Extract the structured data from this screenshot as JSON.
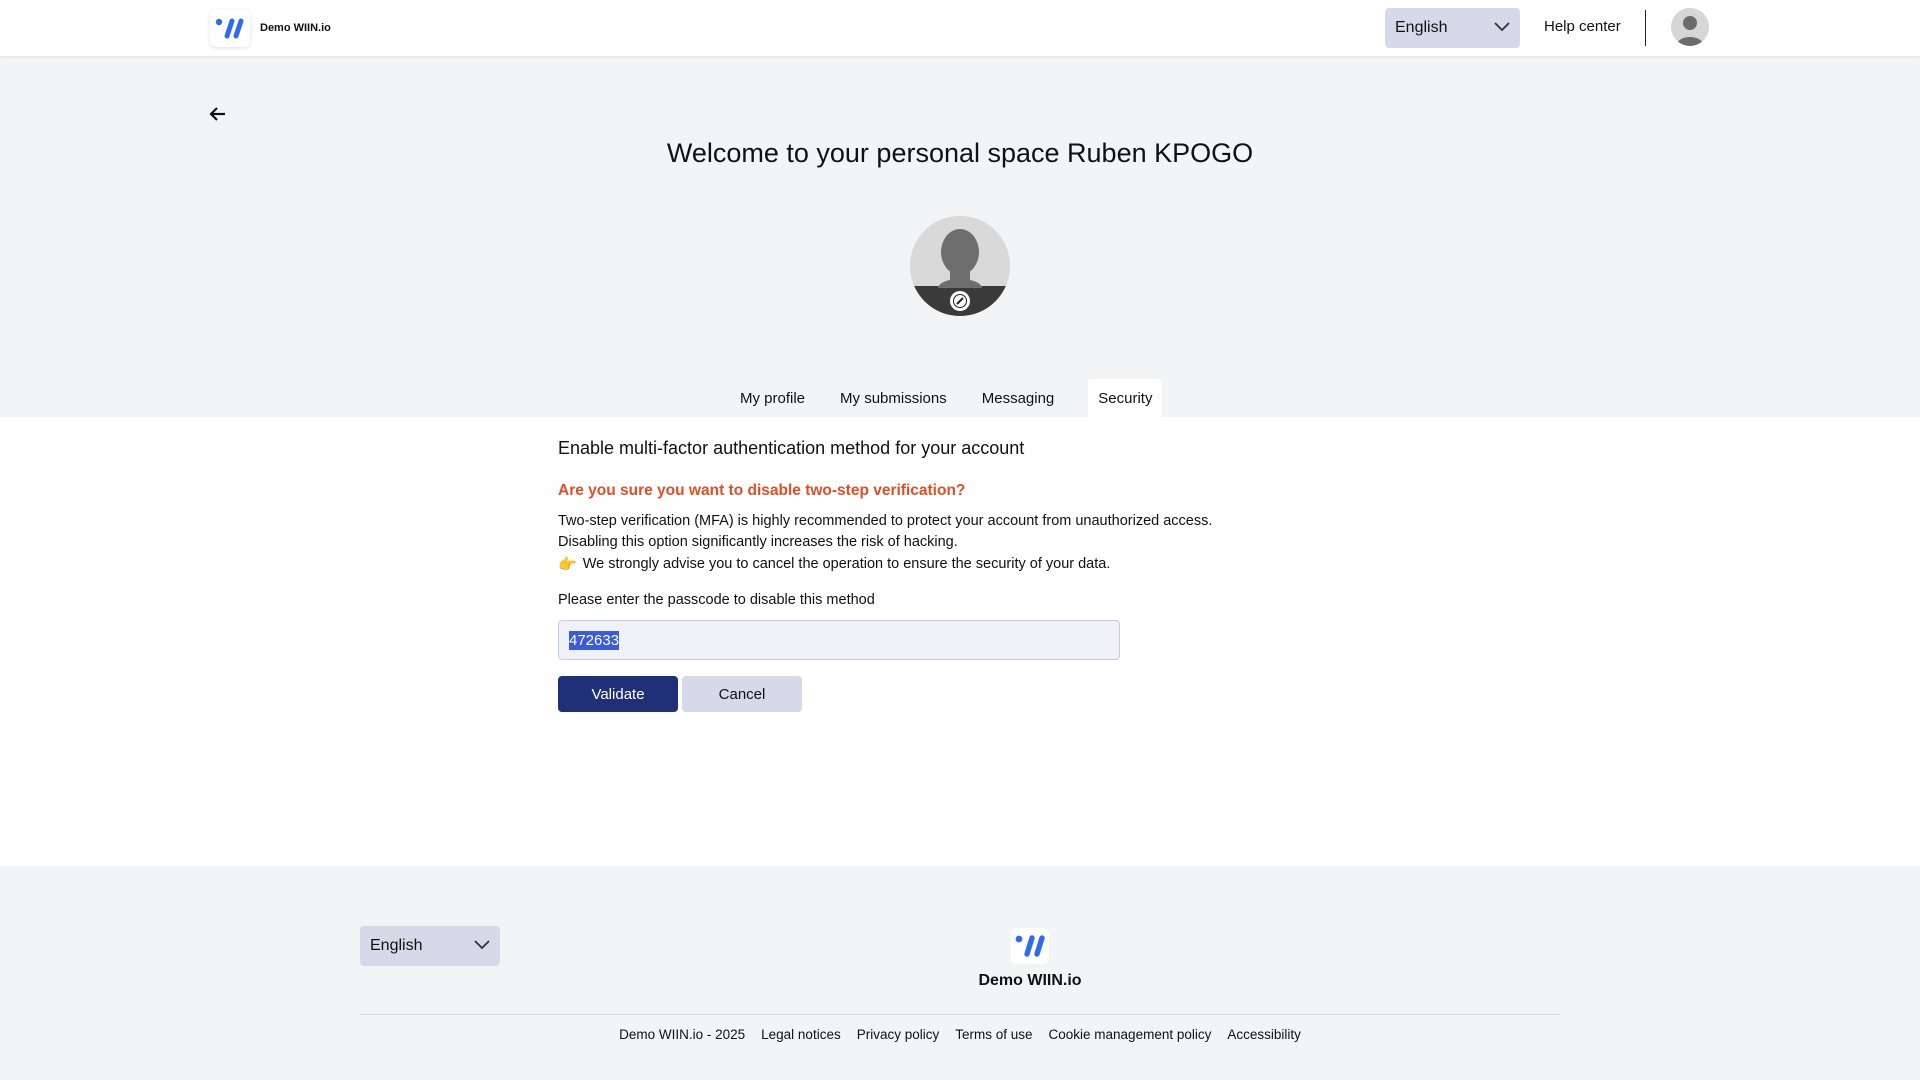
{
  "header": {
    "brand_name": "Demo WIIN.io",
    "language": "English",
    "help_center": "Help center"
  },
  "hero": {
    "welcome": "Welcome to your personal space Ruben KPOGO"
  },
  "tabs": [
    {
      "label": "My profile"
    },
    {
      "label": "My submissions"
    },
    {
      "label": "Messaging"
    },
    {
      "label": "Security",
      "active": true
    }
  ],
  "security": {
    "section_title": "Enable multi-factor authentication method for your account",
    "warning_title": "Are you sure you want to disable two-step verification?",
    "desc_line1": "Two-step verification (MFA) is highly recommended to protect your account from unauthorized access.",
    "desc_line2": "Disabling this option significantly increases the risk of hacking.",
    "desc_line3": "We strongly advise you to cancel the operation to ensure the security of your data.",
    "hand_icon": "👉",
    "field_label": "Please enter the passcode to disable this method",
    "passcode_value": "472633",
    "validate_label": "Validate",
    "cancel_label": "Cancel"
  },
  "footer": {
    "language": "English",
    "brand_name": "Demo WIIN.io",
    "links": {
      "copyright": "Demo WIIN.io - 2025",
      "legal": "Legal notices",
      "privacy": "Privacy policy",
      "terms": "Terms of use",
      "cookies": "Cookie management policy",
      "accessibility": "Accessibility"
    }
  },
  "colors": {
    "accent": "#1f2f78",
    "warning": "#e04e25",
    "logo_blue": "#2f6bf0",
    "select_bg": "#d5d9e8"
  },
  "icons": [
    "wiin-logo-icon",
    "chevron-down-icon",
    "avatar-icon",
    "back-arrow-icon",
    "pencil-icon",
    "pointing-hand-icon"
  ]
}
